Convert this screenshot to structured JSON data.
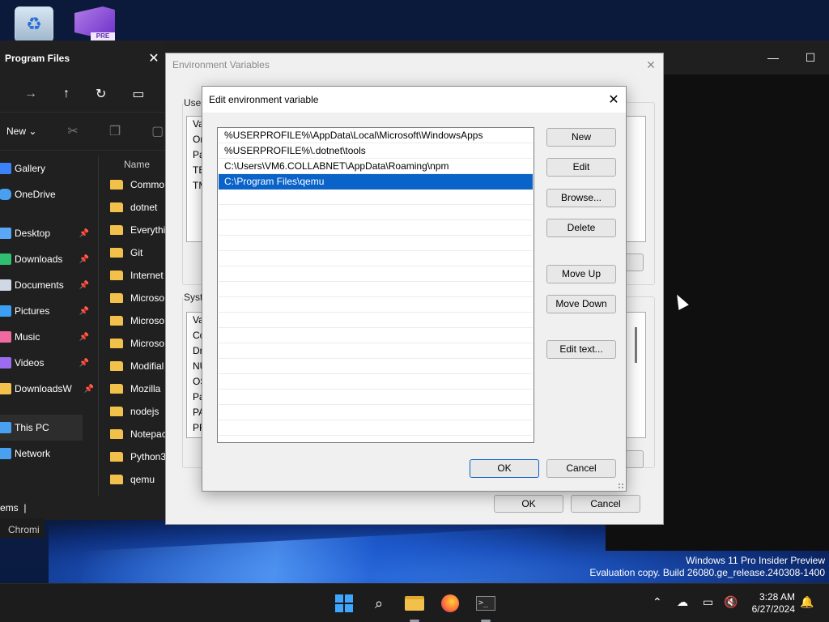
{
  "desktop": {
    "vs_tag": "PRE"
  },
  "explorer": {
    "title": "Program Files",
    "new_label": "New",
    "nav_items": [
      "Gallery",
      "OneDrive",
      "Desktop",
      "Downloads",
      "Documents",
      "Pictures",
      "Music",
      "Videos",
      "DownloadsW",
      "This PC",
      "Network"
    ],
    "column_header": "Name",
    "files": [
      "Commo",
      "dotnet",
      "Everythi",
      "Git",
      "Internet",
      "Microso",
      "Microso",
      "Microso",
      "Modifial",
      "Mozilla",
      "nodejs",
      "Notepac",
      "Python3",
      "qemu"
    ],
    "status": "ems"
  },
  "chromium_label": "Chromi",
  "env_vars": {
    "title": "Environment Variables",
    "user_group": "User",
    "user_rows": [
      "Va",
      "Or",
      "Pa",
      "TE",
      "TM"
    ],
    "system_group": "Syste",
    "system_rows": [
      "Va",
      "Co",
      "Dr",
      "NU",
      "OS",
      "Pa",
      "PA",
      "PR"
    ],
    "ok_label": "OK",
    "cancel_label": "Cancel"
  },
  "edit_dialog": {
    "title": "Edit environment variable",
    "paths": [
      "%USERPROFILE%\\AppData\\Local\\Microsoft\\WindowsApps",
      "%USERPROFILE%\\.dotnet\\tools",
      "C:\\Users\\VM6.COLLABNET\\AppData\\Roaming\\npm",
      "C:\\Program Files\\qemu"
    ],
    "selected_index": 3,
    "buttons": {
      "new": "New",
      "edit": "Edit",
      "browse": "Browse...",
      "delete": "Delete",
      "move_up": "Move Up",
      "move_down": "Move Down",
      "edit_text": "Edit text...",
      "ok": "OK",
      "cancel": "Cancel"
    }
  },
  "watermark": {
    "line1": "Windows 11 Pro Insider Preview",
    "line2": "Evaluation copy. Build 26080.ge_release.240308-1400"
  },
  "taskbar": {
    "time": "3:28 AM",
    "date": "6/27/2024",
    "accent": "#3ea6ff"
  }
}
